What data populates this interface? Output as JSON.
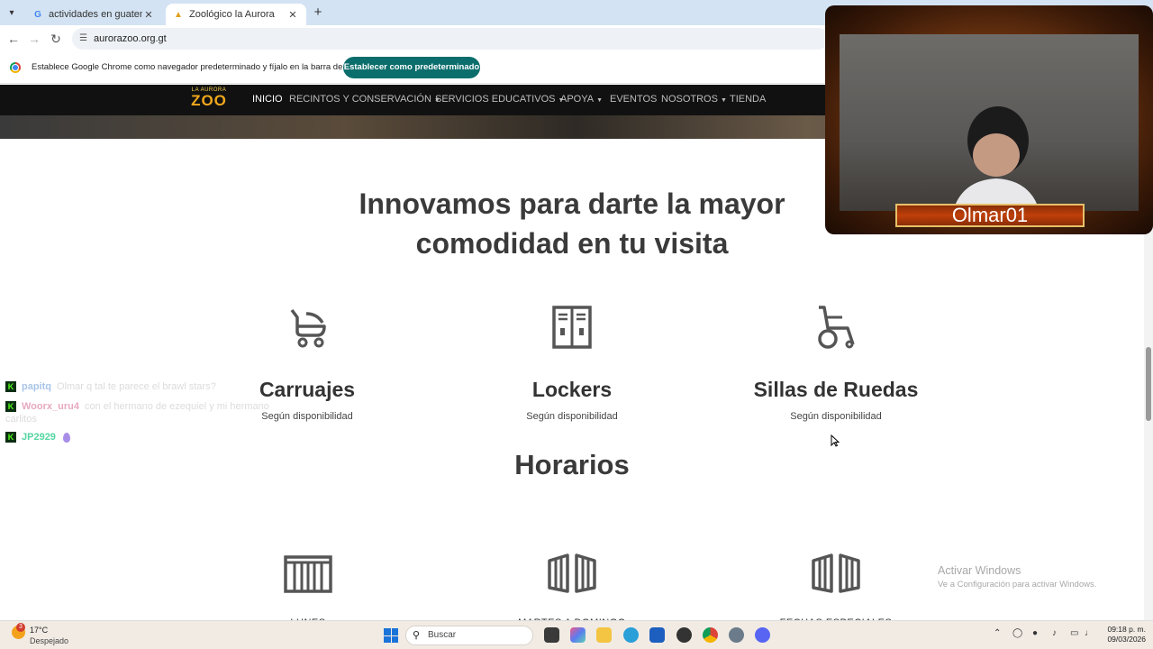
{
  "browser": {
    "tabs": [
      {
        "title": "actividades en guatemala en se",
        "active": false
      },
      {
        "title": "Zoológico la Aurora",
        "active": true
      }
    ],
    "url": "aurorazoo.org.gt",
    "infobar_text": "Establece Google Chrome como navegador predeterminado y fíjalo en la barra de tareas",
    "infobar_button": "Establecer como predeterminado"
  },
  "site": {
    "logo_top": "LA AURORA",
    "logo_main": "ZOO",
    "nav": [
      {
        "label": "INICIO",
        "dropdown": false
      },
      {
        "label": "RECINTOS Y CONSERVACIÓN",
        "dropdown": true
      },
      {
        "label": "SERVICIOS EDUCATIVOS",
        "dropdown": true
      },
      {
        "label": "APOYA",
        "dropdown": true
      },
      {
        "label": "EVENTOS",
        "dropdown": false
      },
      {
        "label": "NOSOTROS",
        "dropdown": true
      },
      {
        "label": "TIENDA",
        "dropdown": false
      }
    ],
    "headline_line1": "Innovamos para darte la mayor",
    "headline_line2": "comodidad en tu visita",
    "features": [
      {
        "title": "Carruajes",
        "subtitle": "Según disponibilidad",
        "icon": "stroller-icon"
      },
      {
        "title": "Lockers",
        "subtitle": "Según disponibilidad",
        "icon": "locker-icon"
      },
      {
        "title": "Sillas de Ruedas",
        "subtitle": "Según disponibilidad",
        "icon": "wheelchair-icon"
      }
    ],
    "schedule_title": "Horarios",
    "schedule": [
      {
        "label": "LUNES",
        "icon": "closed-gate-icon"
      },
      {
        "label": "MARTES A DOMINGO",
        "icon": "open-gate-icon"
      },
      {
        "label": "FECHAS ESPECIALES",
        "icon": "open-gate-icon"
      }
    ]
  },
  "stream": {
    "streamer_name": "Olmar01",
    "chat": [
      {
        "user": "papitq",
        "message": "Olmar q tal te parece el brawl stars?",
        "user_color": "#a9c4e8"
      },
      {
        "user": "Woorx_uru4",
        "message": "con el hermano de ezequiel y mi hermano carlitos",
        "user_color": "#e6a9c0"
      },
      {
        "user": "JP2929",
        "message": "",
        "user_color": "#53d6a0"
      }
    ]
  },
  "watermark": {
    "line1": "Activar Windows",
    "line2": "Ve a Configuración para activar Windows."
  },
  "taskbar": {
    "temp": "17°C",
    "condition": "Despejado",
    "weather_badge": "3",
    "search_placeholder": "Buscar",
    "time": "09:18 p. m.",
    "date": "09/03/2026"
  },
  "colors": {
    "accent_button": "#0b6e6c",
    "nav_bg": "#111111",
    "kick_green": "#53fc18"
  }
}
